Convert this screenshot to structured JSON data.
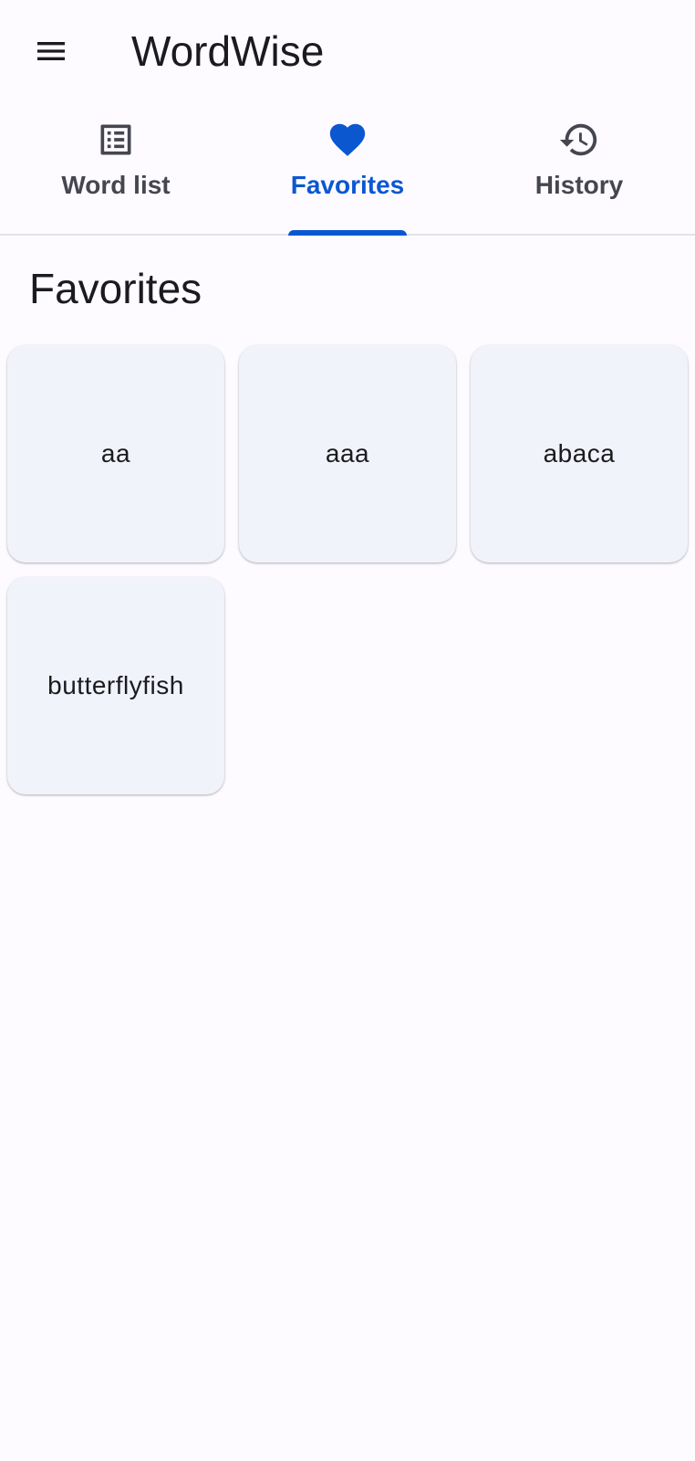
{
  "app": {
    "title": "WordWise",
    "accent_color": "#0b57d0"
  },
  "header": {
    "menu_icon": "hamburger-menu-icon"
  },
  "tabs": [
    {
      "label": "Word list",
      "icon": "list-alt-icon",
      "active": false
    },
    {
      "label": "Favorites",
      "icon": "heart-icon",
      "active": true
    },
    {
      "label": "History",
      "icon": "history-icon",
      "active": false
    }
  ],
  "main": {
    "title": "Favorites",
    "words": [
      "aa",
      "aaa",
      "abaca",
      "butterflyfish"
    ]
  }
}
